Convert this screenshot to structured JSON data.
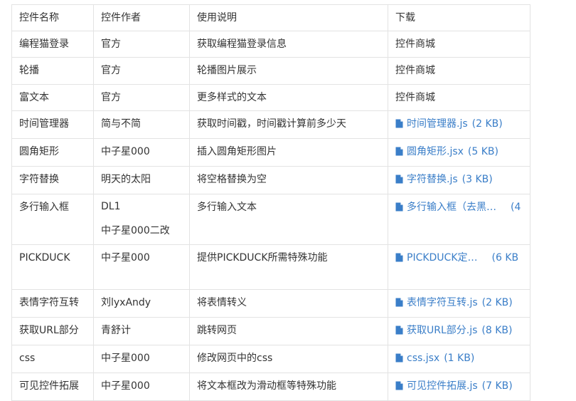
{
  "table": {
    "headers": [
      "控件名称",
      "控件作者",
      "使用说明",
      "下载"
    ],
    "rows": [
      {
        "name": "编程猫登录",
        "authors": [
          "官方"
        ],
        "desc": "获取编程猫登录信息",
        "download": {
          "type": "text",
          "label": "控件商城"
        }
      },
      {
        "name": "轮播",
        "authors": [
          "官方"
        ],
        "desc": "轮播图片展示",
        "download": {
          "type": "text",
          "label": "控件商城"
        }
      },
      {
        "name": "富文本",
        "authors": [
          "官方"
        ],
        "desc": "更多样式的文本",
        "download": {
          "type": "text",
          "label": "控件商城"
        }
      },
      {
        "name": "时间管理器",
        "authors": [
          "简与不简"
        ],
        "desc": "获取时间戳，时间戳计算前多少天",
        "download": {
          "type": "file",
          "filename": "时间管理器.js",
          "size": "(2 KB)",
          "icon": "file-icon"
        }
      },
      {
        "name": "圆角矩形",
        "authors": [
          "中子星000"
        ],
        "desc": "插入圆角矩形图片",
        "download": {
          "type": "file",
          "filename": "圆角矩形.jsx",
          "size": "(5 KB)",
          "icon": "file-icon"
        }
      },
      {
        "name": "字符替换",
        "authors": [
          "明天的太阳"
        ],
        "desc": "将空格替换为空",
        "download": {
          "type": "file",
          "filename": "字符替换.js",
          "size": "(3 KB)",
          "icon": "file-icon"
        }
      },
      {
        "name": "多行输入框",
        "authors": [
          "DL1",
          "中子星000二改"
        ],
        "desc": "多行输入文本",
        "download": {
          "type": "file",
          "filename": "多行输入框（去黑…",
          "size": "(4",
          "icon": "file-icon",
          "truncated": true
        }
      },
      {
        "name": "PICKDUCK",
        "authors": [
          "中子星000"
        ],
        "desc": "提供PICKDUCK所需特殊功能",
        "download": {
          "type": "file",
          "filename": "PICKDUCK定…",
          "size": "(6 KB",
          "icon": "file-icon",
          "truncated": true
        }
      },
      {
        "name": "表情字符互转",
        "authors": [
          "刘lyxAndy"
        ],
        "desc": "将表情转义",
        "download": {
          "type": "file",
          "filename": "表情字符互转.js",
          "size": "(2 KB)",
          "icon": "file-icon"
        }
      },
      {
        "name": "获取URL部分",
        "authors": [
          "青舒计"
        ],
        "desc": "跳转网页",
        "download": {
          "type": "file",
          "filename": "获取URL部分.js",
          "size": "(8 KB)",
          "icon": "file-icon"
        }
      },
      {
        "name": "css",
        "authors": [
          "中子星000"
        ],
        "desc": "修改网页中的css",
        "download": {
          "type": "file",
          "filename": "css.jsx",
          "size": "(1 KB)",
          "icon": "file-icon"
        }
      },
      {
        "name": "可见控件拓展",
        "authors": [
          "中子星000"
        ],
        "desc": "将文本框改为滑动框等特殊功能",
        "download": {
          "type": "file",
          "filename": "可见控件拓展.js",
          "size": "(7 KB)",
          "icon": "file-icon"
        }
      }
    ]
  },
  "colors": {
    "link": "#3a7ec8",
    "border": "#e3e3e3",
    "text": "#333333"
  }
}
